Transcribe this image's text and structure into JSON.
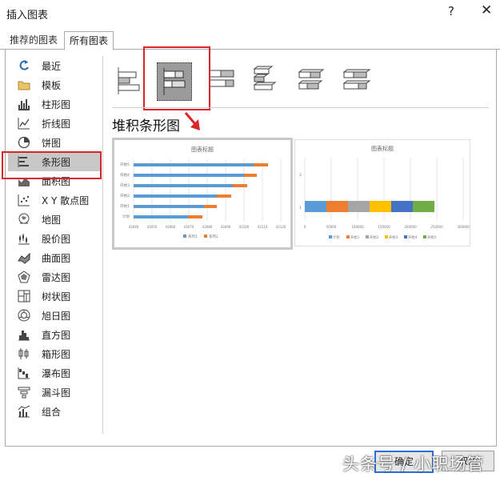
{
  "window": {
    "title": "插入图表",
    "help": "?",
    "close": "✕"
  },
  "tabs": [
    {
      "label": "推荐的图表"
    },
    {
      "label": "所有图表"
    }
  ],
  "sidebar": {
    "items": [
      {
        "label": "最近",
        "icon": "recent-icon"
      },
      {
        "label": "模板",
        "icon": "folder-icon"
      },
      {
        "label": "柱形图",
        "icon": "column-chart-icon"
      },
      {
        "label": "折线图",
        "icon": "line-chart-icon"
      },
      {
        "label": "饼图",
        "icon": "pie-chart-icon"
      },
      {
        "label": "条形图",
        "icon": "bar-chart-icon",
        "selected": true
      },
      {
        "label": "面积图",
        "icon": "area-chart-icon"
      },
      {
        "label": "X Y 散点图",
        "icon": "scatter-chart-icon"
      },
      {
        "label": "地图",
        "icon": "map-chart-icon"
      },
      {
        "label": "股价图",
        "icon": "stock-chart-icon"
      },
      {
        "label": "曲面图",
        "icon": "surface-chart-icon"
      },
      {
        "label": "雷达图",
        "icon": "radar-chart-icon"
      },
      {
        "label": "树状图",
        "icon": "treemap-chart-icon"
      },
      {
        "label": "旭日图",
        "icon": "sunburst-chart-icon"
      },
      {
        "label": "直方图",
        "icon": "histogram-chart-icon"
      },
      {
        "label": "箱形图",
        "icon": "box-chart-icon"
      },
      {
        "label": "瀑布图",
        "icon": "waterfall-chart-icon"
      },
      {
        "label": "漏斗图",
        "icon": "funnel-chart-icon"
      },
      {
        "label": "组合",
        "icon": "combo-chart-icon"
      }
    ]
  },
  "subtype_title": "堆积条形图",
  "preview1": {
    "title": "图表标题",
    "categories": [
      "开始5",
      "开始4",
      "开始3",
      "开始2",
      "开始1",
      "计划"
    ],
    "xticks": [
      "43040",
      "43050",
      "43060",
      "43070",
      "43080",
      "43090",
      "43100",
      "43110",
      "43120"
    ],
    "legend": [
      "系列1",
      "系列2"
    ]
  },
  "preview2": {
    "title": "图表标题",
    "yticks": [
      "2",
      "1"
    ],
    "xticks": [
      "0",
      "50000",
      "100000",
      "150000",
      "200000",
      "250000",
      "300000"
    ],
    "legend": [
      "计划",
      "开始1",
      "开始2",
      "开始3",
      "开始4",
      "开始5"
    ]
  },
  "buttons": {
    "ok": "确定",
    "cancel": "取消"
  },
  "watermark": "头条号 / 小职场管",
  "colors": {
    "blue": "#5b9bd5",
    "orange": "#ed7d31",
    "gray": "#a5a5a5",
    "yellow": "#ffc000",
    "darkblue": "#4472c4",
    "green": "#70ad47",
    "highlight": "#d9262c"
  }
}
